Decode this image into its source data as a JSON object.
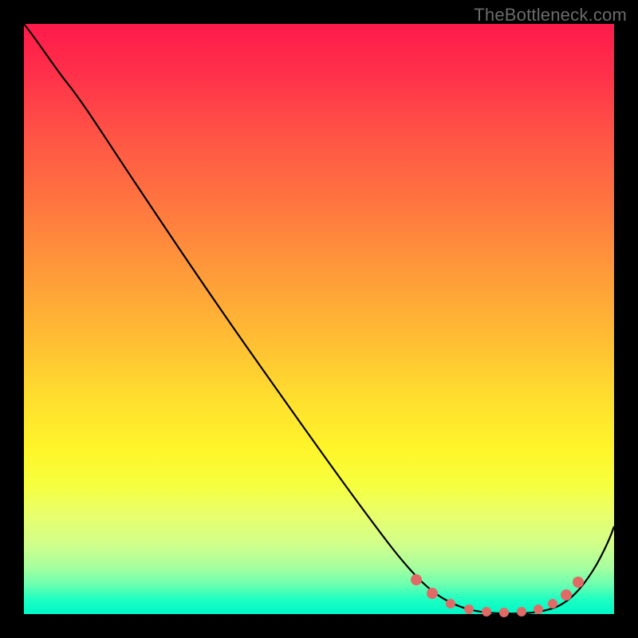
{
  "watermark": "TheBottleneck.com",
  "chart_data": {
    "type": "line",
    "title": "",
    "xlabel": "",
    "ylabel": "",
    "xlim": [
      0,
      100
    ],
    "ylim": [
      0,
      100
    ],
    "series": [
      {
        "name": "bottleneck-curve",
        "x": [
          0,
          3,
          6,
          10,
          16,
          24,
          32,
          40,
          48,
          56,
          62,
          66,
          70,
          74,
          78,
          82,
          86,
          90,
          94,
          98,
          100
        ],
        "y": [
          100,
          97,
          94,
          90,
          82,
          71,
          60,
          49,
          38,
          27,
          18,
          12,
          7,
          3,
          1,
          0,
          0,
          1,
          4,
          10,
          15
        ]
      }
    ],
    "markers": {
      "name": "optimal-region-dots",
      "x": [
        66,
        69,
        72,
        75,
        78,
        81,
        84,
        87,
        89,
        91,
        93
      ],
      "y": [
        11,
        7,
        4,
        2,
        1,
        0.5,
        0.5,
        1,
        2,
        4,
        7
      ]
    },
    "background_gradient": {
      "top_color": "#ff1a4b",
      "mid_color": "#ffe02e",
      "bottom_color": "#00f7c8"
    }
  }
}
